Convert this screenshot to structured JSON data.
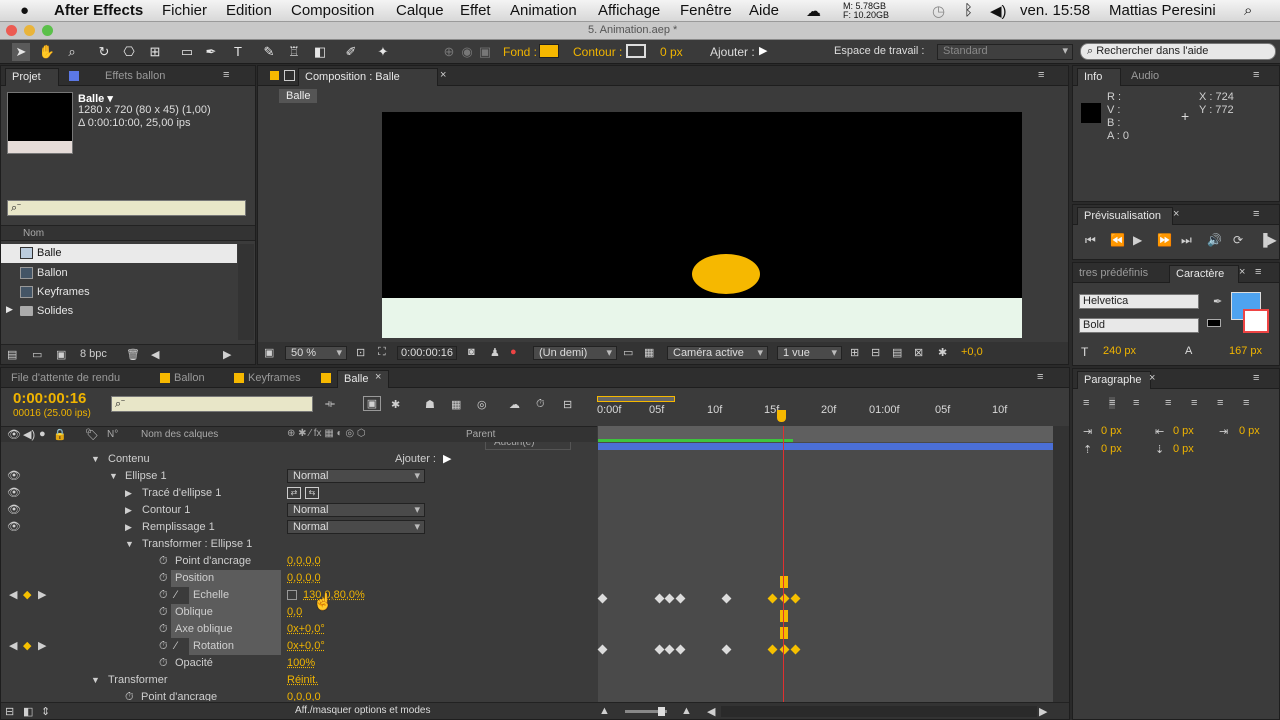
{
  "menubar": {
    "app_name": "After Effects",
    "items": [
      "Fichier",
      "Edition",
      "Composition",
      "Calque",
      "Effet",
      "Animation",
      "Affichage",
      "Fenêtre",
      "Aide"
    ],
    "memory_m": "M: 5.78GB",
    "memory_f": "F: 10.20GB",
    "clock": "ven. 15:58",
    "user": "Mattias Peresini"
  },
  "window": {
    "title": "5. Animation.aep *"
  },
  "toolbar": {
    "fill_label": "Fond :",
    "stroke_label": "Contour :",
    "stroke_width": "0 px",
    "add_label": "Ajouter :",
    "workspace_label": "Espace de travail :",
    "workspace_value": "Standard",
    "help_placeholder": "Rechercher dans l'aide",
    "fill_color": "#f6b800"
  },
  "project": {
    "tab_projet": "Projet",
    "tab_effects": "Effets ballon",
    "comp_name": "Balle ▾",
    "comp_info1": "1280 x 720  (80 x 45) (1,00)",
    "comp_info2": "Δ 0:00:10:00, 25,00 ips",
    "col_name": "Nom",
    "items": [
      {
        "name": "Balle",
        "icon": "composition-icon"
      },
      {
        "name": "Ballon",
        "icon": "composition-icon"
      },
      {
        "name": "Keyframes",
        "icon": "composition-icon"
      },
      {
        "name": "Solides",
        "icon": "folder-icon"
      }
    ],
    "bpc": "8 bpc"
  },
  "composition": {
    "tab_label": "Composition : Balle",
    "breadcrumb": "Balle",
    "zoom": "50 %",
    "timecode": "0:00:00:16",
    "resolution": "(Un demi)",
    "camera": "Caméra active",
    "views": "1 vue",
    "exposure": "+0,0"
  },
  "info": {
    "tab_info": "Info",
    "tab_audio": "Audio",
    "r": "R :",
    "v": "V :",
    "b": "B :",
    "a": "A : 0",
    "x": "X : 724",
    "y": "Y : 772"
  },
  "preview": {
    "tab": "Prévisualisation"
  },
  "character": {
    "tab_presets": "tres prédéfinis",
    "tab_char": "Caractère",
    "font": "Helvetica",
    "style": "Bold",
    "size": "240 px",
    "leading": "167 px"
  },
  "paragraph": {
    "tab": "Paragraphe",
    "values": [
      "0 px",
      "0 px",
      "0 px",
      "0 px",
      "0 px"
    ]
  },
  "timeline": {
    "tabs": [
      "File d'attente de rendu",
      "Ballon",
      "Keyframes",
      "Balle"
    ],
    "timecode": "0:00:00:16",
    "frames": "00016 (25.00 ips)",
    "col_num": "N°",
    "col_name": "Nom des calques",
    "col_parent": "Parent",
    "parent_value": "Aucun(e)",
    "ruler": [
      "0:00f",
      "05f",
      "10f",
      "15f",
      "20f",
      "01:00f",
      "05f",
      "10f"
    ],
    "footer": "Aff./masquer options et modes",
    "rows": [
      {
        "label": "Contenu",
        "add": "Ajouter :"
      },
      {
        "label": "Ellipse 1",
        "mode": "Normal"
      },
      {
        "label": "Tracé d'ellipse 1"
      },
      {
        "label": "Contour 1",
        "mode": "Normal"
      },
      {
        "label": "Remplissage 1",
        "mode": "Normal"
      },
      {
        "label": "Transformer : Ellipse 1"
      },
      {
        "label": "Point d'ancrage",
        "value": "0,0,0,0"
      },
      {
        "label": "Position",
        "value": "0,0,0,0"
      },
      {
        "label": "Echelle",
        "value": "130,0,80,0%"
      },
      {
        "label": "Oblique",
        "value": "0,0"
      },
      {
        "label": "Axe oblique",
        "value": "0x+0,0°"
      },
      {
        "label": "Rotation",
        "value": "0x+0,0°"
      },
      {
        "label": "Opacité",
        "value": "100%"
      },
      {
        "label": "Transformer",
        "value": "Réinit."
      },
      {
        "label": "Point d'ancrage",
        "value": "0,0,0,0"
      }
    ]
  }
}
